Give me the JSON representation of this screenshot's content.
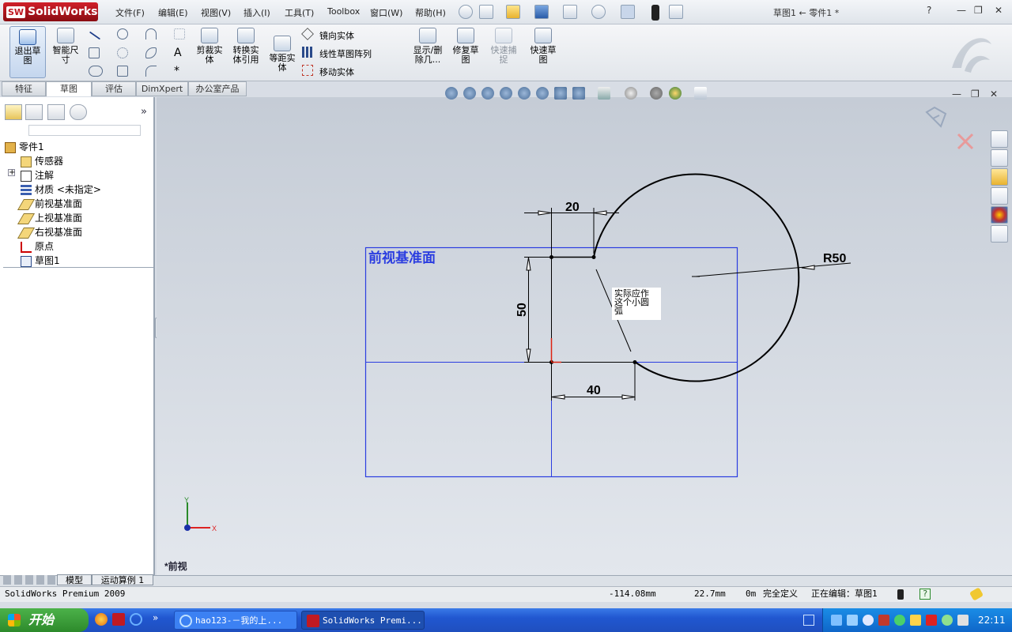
{
  "app": {
    "logo": "SolidWorks",
    "logo_badge": "SW",
    "document_title": "草图1 ← 零件1 *"
  },
  "menu": [
    "文件(F)",
    "编辑(E)",
    "视图(V)",
    "插入(I)",
    "工具(T)",
    "Toolbox",
    "窗口(W)",
    "帮助(H)"
  ],
  "window_controls": {
    "help": "?",
    "minimize": "—",
    "restore": "❐",
    "close": "✕"
  },
  "commands": {
    "exit_sketch": "退出草图",
    "smart_dim": "智能尺寸",
    "trim": "剪裁实体",
    "convert": "转换实体引用",
    "offset": "等距实体",
    "mirror": "镜向实体",
    "linear_pattern": "线性草图阵列",
    "move": "移动实体",
    "show_delete": "显示/删除几...",
    "repair": "修复草图",
    "quick_snap": "快速捕捉",
    "rapid_sketch": "快速草图"
  },
  "tabs": [
    "特征",
    "草图",
    "评估",
    "DimXpert",
    "办公室产品"
  ],
  "active_tab": "草图",
  "feature_tree": {
    "expand_button": "»",
    "expander": "+",
    "items": [
      {
        "label": "零件1",
        "icon": "part-icon"
      },
      {
        "label": "传感器",
        "icon": "sensor-icon"
      },
      {
        "label": "注解",
        "icon": "annotation-icon"
      },
      {
        "label": "材质 <未指定>",
        "icon": "material-icon"
      },
      {
        "label": "前视基准面",
        "icon": "plane-icon"
      },
      {
        "label": "上视基准面",
        "icon": "plane-icon"
      },
      {
        "label": "右视基准面",
        "icon": "plane-icon"
      },
      {
        "label": "原点",
        "icon": "origin-icon"
      },
      {
        "label": "草图1",
        "icon": "sketch-icon"
      }
    ]
  },
  "graphics": {
    "plane_label": "前视基准面",
    "view_label": "*前视",
    "dim_20": "20",
    "dim_50": "50",
    "dim_40": "40",
    "dim_r50": "R50",
    "note_lines": [
      "实际应作",
      "这个小圆",
      "弧"
    ],
    "axis_x": "X",
    "axis_y": "Y",
    "colors": {
      "plane": "#2b3de0",
      "sketch": "#000000",
      "dim": "#000000"
    }
  },
  "bottom_tabs": [
    "模型",
    "运动算例 1"
  ],
  "status": {
    "product": "SolidWorks Premium 2009",
    "x": "-114.08mm",
    "y": "22.7mm",
    "z": "0m",
    "definition": "完全定义",
    "editing": "正在编辑：草图1",
    "help": "?"
  },
  "taskbar": {
    "start": "开始",
    "tasks": [
      "hao123-－我的上...",
      "SolidWorks Premi..."
    ],
    "clock": "22:11",
    "expand": "»"
  }
}
